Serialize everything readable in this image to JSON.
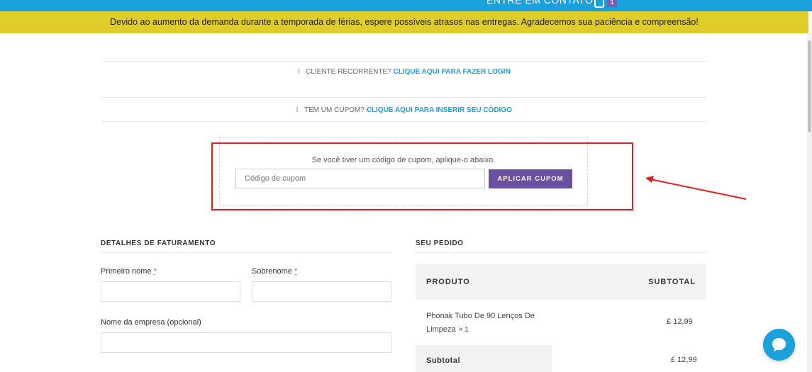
{
  "topbar": {
    "contact_label": "ENTRE EM CONTATO",
    "cart_count": "1"
  },
  "notice": {
    "text": "Devido ao aumento da demanda durante a temporada de férias, espere possíveis atrasos nas entregas. Agradecemos sua paciência e compreensão!"
  },
  "login_prompt": {
    "text": "CLIENTE RECORRENTE?",
    "link": "CLIQUE AQUI PARA FAZER LOGIN"
  },
  "coupon_prompt": {
    "text": "TEM UM CUPOM?",
    "link": "CLIQUE AQUI PARA INSERIR SEU CÓDIGO"
  },
  "coupon_form": {
    "message": "Se você tiver um código de cupom, aplique-o abaixo.",
    "placeholder": "Código de cupom",
    "button_label": "APLICAR CUPOM"
  },
  "billing": {
    "title": "DETALHES DE FATURAMENTO",
    "first_name_label": "Primeiro nome",
    "last_name_label": "Sobrenome",
    "required_mark": "*",
    "company_label": "Nome da empresa  (opcional)"
  },
  "order": {
    "title": "SEU PEDIDO",
    "col_product": "PRODUTO",
    "col_subtotal": "SUBTOTAL",
    "item_name": "Phonak Tubo De 90 Lenços De Limpeza",
    "item_qty": "× 1",
    "item_price": "£ 12,99",
    "subtotal_label": "Subtotal",
    "subtotal_value": "£ 12,99"
  },
  "colors": {
    "accent_blue": "#1aa0dc",
    "notice_yellow": "#e0cd29",
    "button_purple": "#6b4fa0",
    "annotation_red": "#e21d1d"
  }
}
